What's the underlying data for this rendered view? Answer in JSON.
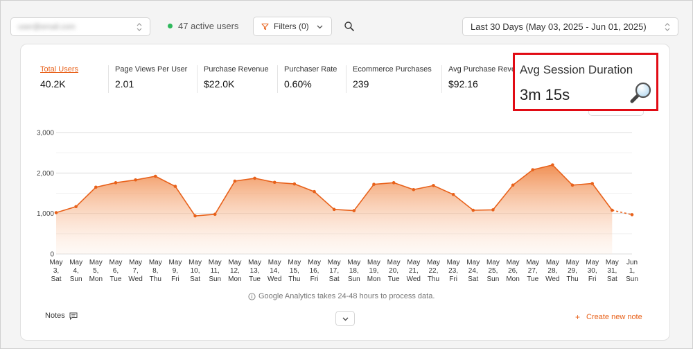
{
  "topbar": {
    "site_select_value": "user@email.com",
    "active_users": "47 active users",
    "filters_label": "Filters (0)",
    "date_range": "Last 30 Days (May 03, 2025 - Jun 01, 2025)"
  },
  "metrics": [
    {
      "label": "Total Users",
      "value": "40.2K",
      "active": true
    },
    {
      "label": "Page Views Per User",
      "value": "2.01"
    },
    {
      "label": "Purchase Revenue",
      "value": "$22.0K"
    },
    {
      "label": "Purchaser Rate",
      "value": "0.60%"
    },
    {
      "label": "Ecommerce Purchases",
      "value": "239"
    },
    {
      "label": "Avg Purchase Revenue",
      "value": "$92.16"
    }
  ],
  "highlighted_metric": {
    "label": "Avg Session Duration",
    "value": "3m 15s"
  },
  "chart_data": {
    "type": "area",
    "series_color": "#e8611a",
    "ylim": [
      0,
      3000
    ],
    "yticks": [
      "0",
      "1,000",
      "2,000",
      "3,000"
    ],
    "x": [
      [
        "May",
        "3,",
        "Sat"
      ],
      [
        "May",
        "4,",
        "Sun"
      ],
      [
        "May",
        "5,",
        "Mon"
      ],
      [
        "May",
        "6,",
        "Tue"
      ],
      [
        "May",
        "7,",
        "Wed"
      ],
      [
        "May",
        "8,",
        "Thu"
      ],
      [
        "May",
        "9,",
        "Fri"
      ],
      [
        "May",
        "10,",
        "Sat"
      ],
      [
        "May",
        "11,",
        "Sun"
      ],
      [
        "May",
        "12,",
        "Mon"
      ],
      [
        "May",
        "13,",
        "Tue"
      ],
      [
        "May",
        "14,",
        "Wed"
      ],
      [
        "May",
        "15,",
        "Thu"
      ],
      [
        "May",
        "16,",
        "Fri"
      ],
      [
        "May",
        "17,",
        "Sat"
      ],
      [
        "May",
        "18,",
        "Sun"
      ],
      [
        "May",
        "19,",
        "Mon"
      ],
      [
        "May",
        "20,",
        "Tue"
      ],
      [
        "May",
        "21,",
        "Wed"
      ],
      [
        "May",
        "22,",
        "Thu"
      ],
      [
        "May",
        "23,",
        "Fri"
      ],
      [
        "May",
        "24,",
        "Sat"
      ],
      [
        "May",
        "25,",
        "Sun"
      ],
      [
        "May",
        "26,",
        "Mon"
      ],
      [
        "May",
        "27,",
        "Tue"
      ],
      [
        "May",
        "28,",
        "Wed"
      ],
      [
        "May",
        "29,",
        "Thu"
      ],
      [
        "May",
        "30,",
        "Fri"
      ],
      [
        "May",
        "31,",
        "Sat"
      ],
      [
        "Jun",
        "1,",
        "Sun"
      ]
    ],
    "values": [
      1020,
      1170,
      1650,
      1760,
      1830,
      1920,
      1670,
      940,
      980,
      1800,
      1870,
      1770,
      1730,
      1540,
      1100,
      1070,
      1720,
      1760,
      1590,
      1690,
      1470,
      1080,
      1090,
      1700,
      2080,
      2200,
      1700,
      1740,
      1080,
      970
    ],
    "last_segment_dashed": true
  },
  "footer": {
    "ga_note": "Google Analytics takes 24-48 hours to process data.",
    "notes_label": "Notes",
    "create_note": "Create new note"
  }
}
